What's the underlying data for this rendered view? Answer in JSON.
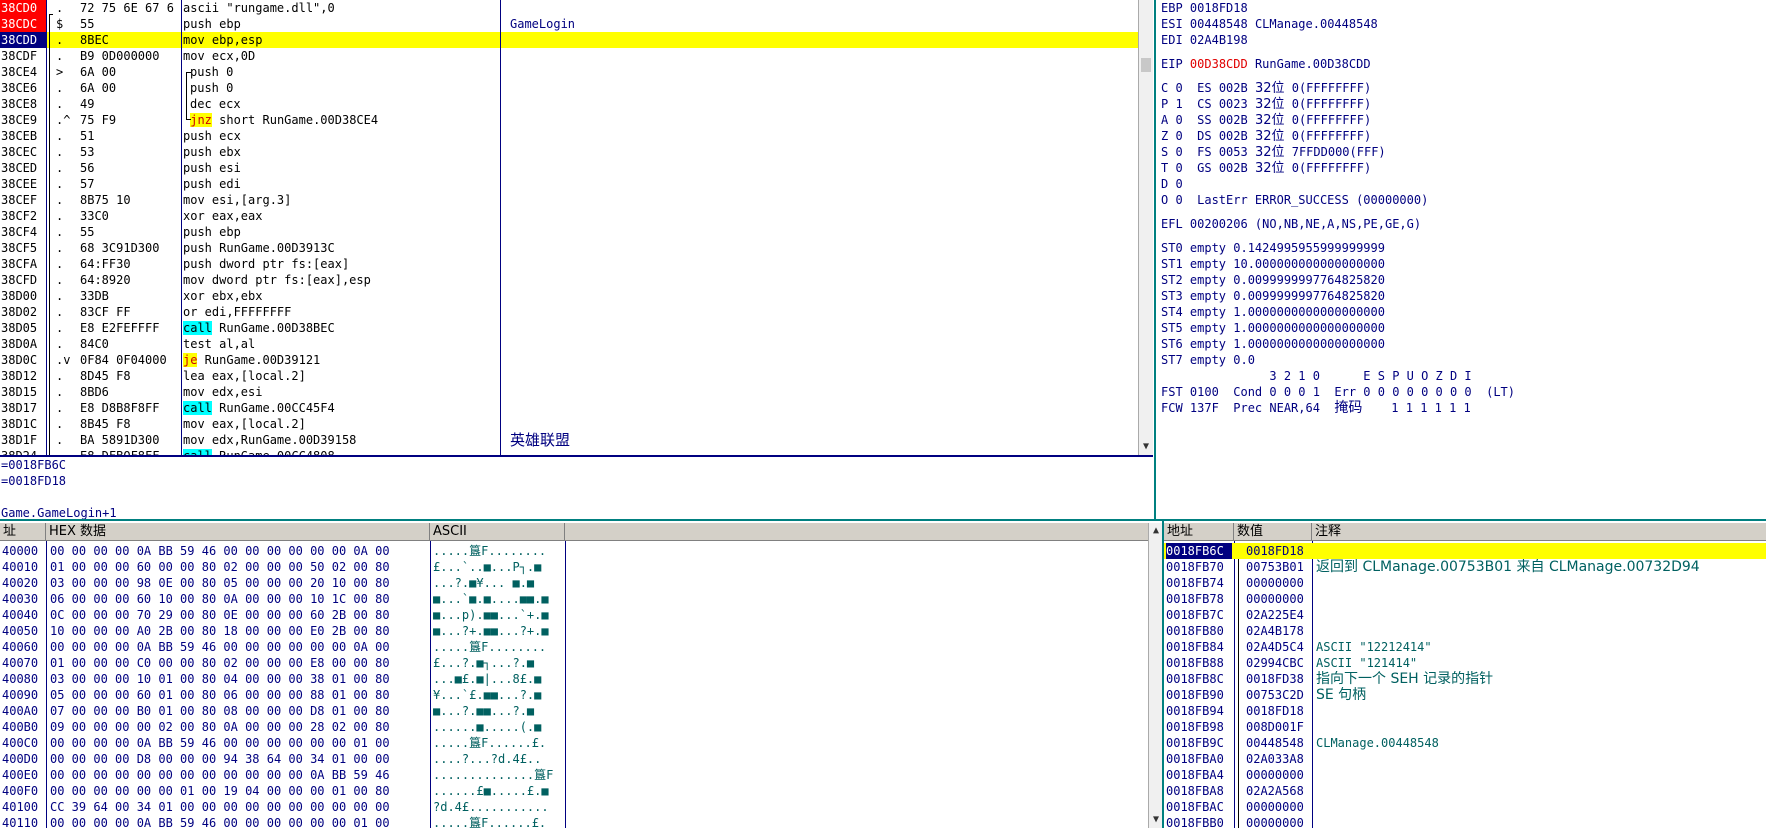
{
  "disasm": {
    "rows": [
      {
        "addr": "38CD0",
        "mark": ".",
        "hex": "72 75 6E 67 6",
        "instr": "ascii \"rungame.dll\",0",
        "comment": "",
        "hl": "",
        "addrhl": "red"
      },
      {
        "addr": "38CDC",
        "mark": "$",
        "hex": "55",
        "instr": "push ebp",
        "comment": "GameLogin",
        "hl": "",
        "addrhl": "red"
      },
      {
        "addr": "38CDD",
        "mark": ".",
        "hex": "8BEC",
        "instr": "mov ebp,esp",
        "comment": "",
        "hl": "yellow",
        "addrhl": "navy"
      },
      {
        "addr": "38CDF",
        "mark": ".",
        "hex": "B9 0D000000",
        "instr": "mov ecx,0D",
        "comment": "",
        "hl": "",
        "addrhl": ""
      },
      {
        "addr": "38CE4",
        "mark": ">",
        "hex": "6A 00",
        "instr": "push 0",
        "comment": "",
        "hl": "",
        "addrhl": ""
      },
      {
        "addr": "38CE6",
        "mark": ".",
        "hex": "6A 00",
        "instr": "push 0",
        "comment": "",
        "hl": "",
        "addrhl": ""
      },
      {
        "addr": "38CE8",
        "mark": ".",
        "hex": "49",
        "instr": "dec ecx",
        "comment": "",
        "hl": "",
        "addrhl": ""
      },
      {
        "addr": "38CE9",
        "mark": ".^",
        "hex": "75 F9",
        "instr": "jnz short RunGame.00D38CE4",
        "comment": "",
        "hl": "",
        "addrhl": ""
      },
      {
        "addr": "38CEB",
        "mark": ".",
        "hex": "51",
        "instr": "push ecx",
        "comment": "",
        "hl": "",
        "addrhl": ""
      },
      {
        "addr": "38CEC",
        "mark": ".",
        "hex": "53",
        "instr": "push ebx",
        "comment": "",
        "hl": "",
        "addrhl": ""
      },
      {
        "addr": "38CED",
        "mark": ".",
        "hex": "56",
        "instr": "push esi",
        "comment": "",
        "hl": "",
        "addrhl": ""
      },
      {
        "addr": "38CEE",
        "mark": ".",
        "hex": "57",
        "instr": "push edi",
        "comment": "",
        "hl": "",
        "addrhl": ""
      },
      {
        "addr": "38CEF",
        "mark": ".",
        "hex": "8B75 10",
        "instr": "mov esi,[arg.3]",
        "comment": "",
        "hl": "",
        "addrhl": ""
      },
      {
        "addr": "38CF2",
        "mark": ".",
        "hex": "33C0",
        "instr": "xor eax,eax",
        "comment": "",
        "hl": "",
        "addrhl": ""
      },
      {
        "addr": "38CF4",
        "mark": ".",
        "hex": "55",
        "instr": "push ebp",
        "comment": "",
        "hl": "",
        "addrhl": ""
      },
      {
        "addr": "38CF5",
        "mark": ".",
        "hex": "68 3C91D300",
        "instr": "push RunGame.00D3913C",
        "comment": "",
        "hl": "",
        "addrhl": ""
      },
      {
        "addr": "38CFA",
        "mark": ".",
        "hex": "64:FF30",
        "instr": "push dword ptr fs:[eax]",
        "comment": "",
        "hl": "",
        "addrhl": ""
      },
      {
        "addr": "38CFD",
        "mark": ".",
        "hex": "64:8920",
        "instr": "mov dword ptr fs:[eax],esp",
        "comment": "",
        "hl": "",
        "addrhl": ""
      },
      {
        "addr": "38D00",
        "mark": ".",
        "hex": "33DB",
        "instr": "xor ebx,ebx",
        "comment": "",
        "hl": "",
        "addrhl": ""
      },
      {
        "addr": "38D02",
        "mark": ".",
        "hex": "83CF FF",
        "instr": "or edi,FFFFFFFF",
        "comment": "",
        "hl": "",
        "addrhl": ""
      },
      {
        "addr": "38D05",
        "mark": ".",
        "hex": "E8 E2FEFFFF",
        "instr": "call RunGame.00D38BEC",
        "comment": "",
        "hl": "",
        "addrhl": ""
      },
      {
        "addr": "38D0A",
        "mark": ".",
        "hex": "84C0",
        "instr": "test al,al",
        "comment": "",
        "hl": "",
        "addrhl": ""
      },
      {
        "addr": "38D0C",
        "mark": ".v",
        "hex": "0F84 0F04000",
        "instr": "je RunGame.00D39121",
        "comment": "",
        "hl": "",
        "addrhl": ""
      },
      {
        "addr": "38D12",
        "mark": ".",
        "hex": "8D45 F8",
        "instr": "lea eax,[local.2]",
        "comment": "",
        "hl": "",
        "addrhl": ""
      },
      {
        "addr": "38D15",
        "mark": ".",
        "hex": "8BD6",
        "instr": "mov edx,esi",
        "comment": "",
        "hl": "",
        "addrhl": ""
      },
      {
        "addr": "38D17",
        "mark": ".",
        "hex": "E8 D8B8F8FF",
        "instr": "call RunGame.00CC45F4",
        "comment": "",
        "hl": "",
        "addrhl": ""
      },
      {
        "addr": "38D1C",
        "mark": ".",
        "hex": "8B45 F8",
        "instr": "mov eax,[local.2]",
        "comment": "",
        "hl": "",
        "addrhl": ""
      },
      {
        "addr": "38D1F",
        "mark": ".",
        "hex": "BA 5891D300",
        "instr": "mov edx,RunGame.00D39158",
        "comment": "英雄联盟",
        "hl": "",
        "addrhl": ""
      },
      {
        "addr": "38D24",
        "mark": ".",
        "hex": "E8 DFBOF8FF",
        "instr": "call RunGame.00CC4808",
        "comment": "",
        "hl": "",
        "addrhl": ""
      }
    ]
  },
  "info": {
    "lines": [
      "=0018FB6C",
      "=0018FD18",
      "",
      "Game.GameLogin+1"
    ]
  },
  "registers": {
    "top": [
      {
        "name": "EBP",
        "value": "0018FD18",
        "desc": ""
      },
      {
        "name": "ESI",
        "value": "00448548",
        "desc": "CLManage.00448548"
      },
      {
        "name": "EDI",
        "value": "02A4B198",
        "desc": ""
      }
    ],
    "eip": {
      "name": "EIP",
      "value": "00D38CDD",
      "desc": "RunGame.00D38CDD"
    },
    "segs": [
      {
        "flag": "C 0",
        "seg": "ES 002B",
        "bits": "32位",
        "base": "0(FFFFFFFF)"
      },
      {
        "flag": "P 1",
        "seg": "CS 0023",
        "bits": "32位",
        "base": "0(FFFFFFFF)"
      },
      {
        "flag": "A 0",
        "seg": "SS 002B",
        "bits": "32位",
        "base": "0(FFFFFFFF)"
      },
      {
        "flag": "Z 0",
        "seg": "DS 002B",
        "bits": "32位",
        "base": "0(FFFFFFFF)"
      },
      {
        "flag": "S 0",
        "seg": "FS 0053",
        "bits": "32位",
        "base": "7FFDD000(FFF)"
      },
      {
        "flag": "T 0",
        "seg": "GS 002B",
        "bits": "32位",
        "base": "0(FFFFFFFF)"
      },
      {
        "flag": "D 0",
        "seg": "",
        "bits": "",
        "base": ""
      }
    ],
    "lasterr": "O 0  LastErr ERROR_SUCCESS (00000000)",
    "efl": "EFL 00200206 (NO,NB,NE,A,NS,PE,GE,G)",
    "st": [
      "ST0 empty 0.1424995955999999999",
      "ST1 empty 10.000000000000000000",
      "ST2 empty 0.0099999997764825820",
      "ST3 empty 0.0099999997764825820",
      "ST4 empty 1.0000000000000000000",
      "ST5 empty 1.0000000000000000000",
      "ST6 empty 1.0000000000000000000",
      "ST7 empty 0.0"
    ],
    "fst_head": "               3 2 1 0      E S P U O Z D I",
    "fst": "FST 0100  Cond 0 0 0 1  Err 0 0 0 0 0 0 0 0  (LT)",
    "fcw": "FCW 137F  Prec NEAR,64  ",
    "fcw_mask": "掩码",
    "fcw_bits": "    1 1 1 1 1 1"
  },
  "dump": {
    "headers": {
      "addr": "址",
      "hex": "HEX 数据",
      "ascii": "ASCII"
    },
    "rows": [
      {
        "addr": "40000",
        "hex": "00 00 00 00 0A BB 59 46 00 00 00 00 00 00 0A 00",
        "ascii": ".....簋F........"
      },
      {
        "addr": "40010",
        "hex": "01 00 00 00 60 00 00 80 02 00 00 00 50 02 00 80",
        "ascii": "£...`..■...P┐.■"
      },
      {
        "addr": "40020",
        "hex": "03 00 00 00 98 0E 00 80 05 00 00 00 20 10 00 80",
        "ascii": "...?.■¥... ■.■"
      },
      {
        "addr": "40030",
        "hex": "06 00 00 00 60 10 00 80 0A 00 00 00 10 1C 00 80",
        "ascii": "■...`■.■....■■.■"
      },
      {
        "addr": "40040",
        "hex": "0C 00 00 00 70 29 00 80 0E 00 00 00 60 2B 00 80",
        "ascii": "■...p).■■...`+.■"
      },
      {
        "addr": "40050",
        "hex": "10 00 00 00 A0 2B 00 80 18 00 00 00 E0 2B 00 80",
        "ascii": "■...?+.■■...?+.■"
      },
      {
        "addr": "40060",
        "hex": "00 00 00 00 0A BB 59 46 00 00 00 00 00 00 0A 00",
        "ascii": ".....簋F........"
      },
      {
        "addr": "40070",
        "hex": "01 00 00 00 C0 00 00 80 02 00 00 00 E8 00 00 80",
        "ascii": "£...?.■┐...?.■"
      },
      {
        "addr": "40080",
        "hex": "03 00 00 00 10 01 00 80 04 00 00 00 38 01 00 80",
        "ascii": "...■£.■|...8£.■"
      },
      {
        "addr": "40090",
        "hex": "05 00 00 00 60 01 00 80 06 00 00 00 88 01 00 80",
        "ascii": "¥...`£.■■...?.■"
      },
      {
        "addr": "400A0",
        "hex": "07 00 00 00 B0 01 00 80 08 00 00 00 D8 01 00 80",
        "ascii": "■...?.■■...?.■"
      },
      {
        "addr": "400B0",
        "hex": "09 00 00 00 00 02 00 80 0A 00 00 00 28 02 00 80",
        "ascii": "......■.....(.■"
      },
      {
        "addr": "400C0",
        "hex": "00 00 00 00 0A BB 59 46 00 00 00 00 00 00 01 00",
        "ascii": ".....簋F......£."
      },
      {
        "addr": "400D0",
        "hex": "00 00 00 00 D8 00 00 00 94 38 64 00 34 01 00 00",
        "ascii": "....?...?d.4£.."
      },
      {
        "addr": "400E0",
        "hex": "00 00 00 00 00 00 00 00 00 00 00 00 0A BB 59 46",
        "ascii": "..............簋F"
      },
      {
        "addr": "400F0",
        "hex": "00 00 00 00 00 00 01 00 19 04 00 00 00 01 00 80",
        "ascii": "......£■.....£.■"
      },
      {
        "addr": "40100",
        "hex": "CC 39 64 00 34 01 00 00 00 00 00 00 00 00 00 00",
        "ascii": "?d.4£..........."
      },
      {
        "addr": "40110",
        "hex": "00 00 00 00 0A BB 59 46 00 00 00 00 00 00 01 00",
        "ascii": ".....簋F......£."
      }
    ]
  },
  "stack": {
    "headers": {
      "addr": "地址",
      "value": "数值",
      "comment": "注释"
    },
    "rows": [
      {
        "addr": "0018FB6C",
        "value": "0018FD18",
        "comment": "",
        "hl": true
      },
      {
        "addr": "0018FB70",
        "value": "00753B01",
        "comment": "返回到 CLManage.00753B01 来自 CLManage.00732D94"
      },
      {
        "addr": "0018FB74",
        "value": "00000000",
        "comment": ""
      },
      {
        "addr": "0018FB78",
        "value": "00000000",
        "comment": ""
      },
      {
        "addr": "0018FB7C",
        "value": "02A225E4",
        "comment": ""
      },
      {
        "addr": "0018FB80",
        "value": "02A4B178",
        "comment": ""
      },
      {
        "addr": "0018FB84",
        "value": "02A4D5C4",
        "comment": "ASCII \"12212414\""
      },
      {
        "addr": "0018FB88",
        "value": "02994CBC",
        "comment": "ASCII \"121414\""
      },
      {
        "addr": "0018FB8C",
        "value": "0018FD38",
        "comment": "指向下一个 SEH 记录的指针"
      },
      {
        "addr": "0018FB90",
        "value": "00753C2D",
        "comment": "SE 句柄"
      },
      {
        "addr": "0018FB94",
        "value": "0018FD18",
        "comment": ""
      },
      {
        "addr": "0018FB98",
        "value": "008D001F",
        "comment": ""
      },
      {
        "addr": "0018FB9C",
        "value": "00448548",
        "comment": "CLManage.00448548"
      },
      {
        "addr": "0018FBA0",
        "value": "02A033A8",
        "comment": ""
      },
      {
        "addr": "0018FBA4",
        "value": "00000000",
        "comment": ""
      },
      {
        "addr": "0018FBA8",
        "value": "02A2A568",
        "comment": ""
      },
      {
        "addr": "0018FBAC",
        "value": "00000000",
        "comment": ""
      },
      {
        "addr": "0018FBB0",
        "value": "00000000",
        "comment": ""
      }
    ]
  }
}
